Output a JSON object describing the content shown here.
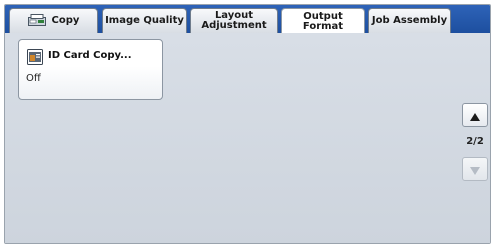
{
  "tabs": [
    {
      "label": "Copy",
      "icon": "copy-icon",
      "active": false
    },
    {
      "label": "Image Quality",
      "active": false
    },
    {
      "label": "Layout\nAdjustment",
      "active": false
    },
    {
      "label": "Output Format",
      "active": true
    },
    {
      "label": "Job Assembly",
      "active": false
    }
  ],
  "features": [
    {
      "label": "ID Card Copy...",
      "value": "Off",
      "icon": "id-card-icon"
    }
  ],
  "pagination": {
    "indicator": "2/2"
  },
  "colors": {
    "tab_bar": "#1d4f9f",
    "panel": "#d3d9e1",
    "arrow_active": "#1a1a1a",
    "arrow_disabled": "#b5bcc5"
  }
}
